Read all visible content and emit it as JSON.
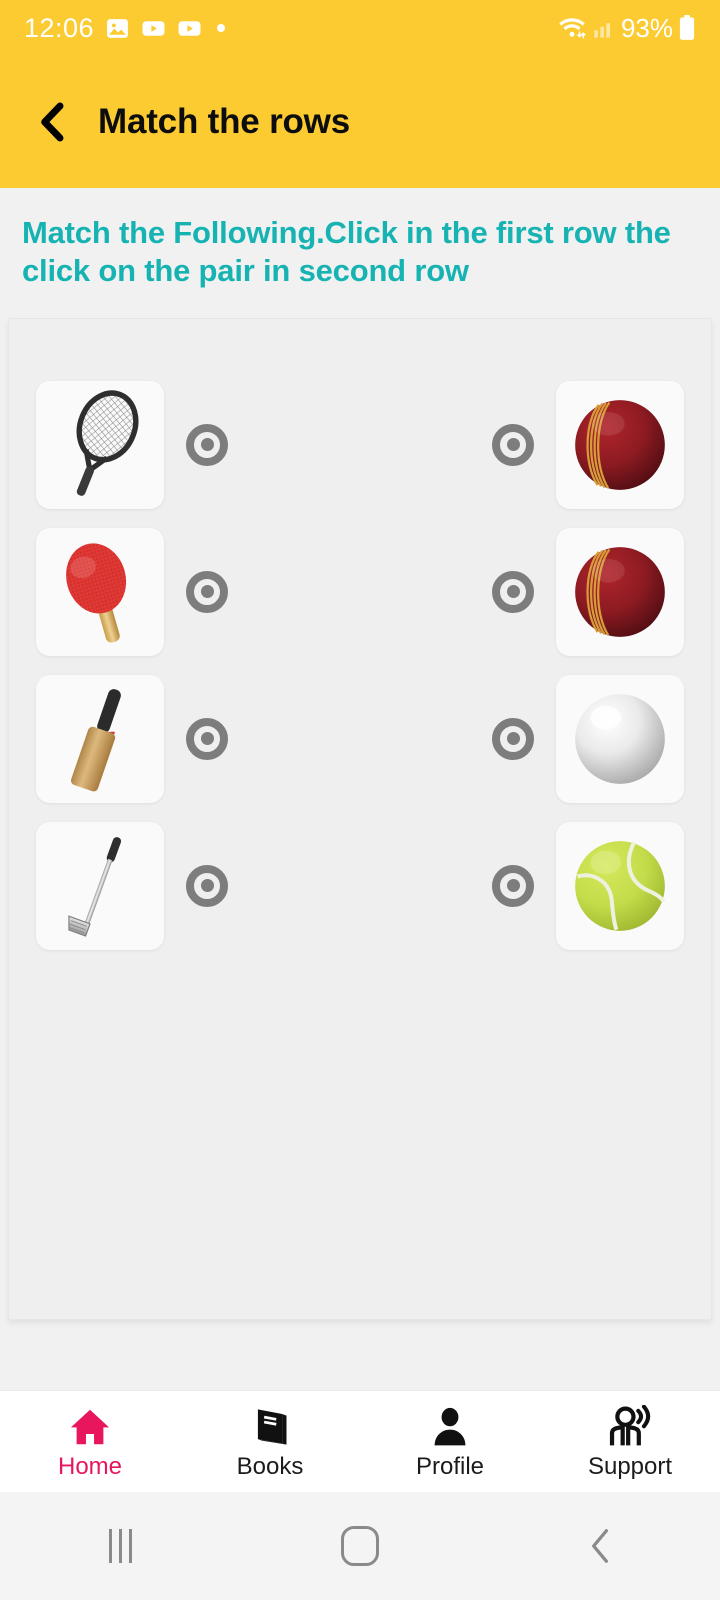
{
  "status_bar": {
    "time": "12:06",
    "battery_percent": "93%",
    "icons": [
      "image-icon",
      "youtube-icon",
      "youtube-icon",
      "dot-indicator",
      "wifi-icon",
      "signal-icon",
      "battery-icon"
    ]
  },
  "app_bar": {
    "back_label": "Back",
    "title": "Match the rows",
    "background_color": "#fccb32",
    "title_color": "#0d0d0d"
  },
  "instruction": {
    "text": "Match the Following.Click in the first row the click on the pair in second row",
    "color": "#17b3b3"
  },
  "match_game": {
    "rows": [
      {
        "left_item": "tennis-racket",
        "left_label": "Tennis racket",
        "right_item": "cricket-ball-red",
        "right_label": "Red cricket ball",
        "left_selected": true,
        "right_selected": true
      },
      {
        "left_item": "table-tennis-paddle",
        "left_label": "Table tennis paddle",
        "right_item": "cricket-ball-red",
        "right_label": "Red cricket ball",
        "left_selected": true,
        "right_selected": true
      },
      {
        "left_item": "cricket-bat",
        "left_label": "Cricket bat",
        "right_item": "white-ball",
        "right_label": "White ball",
        "left_selected": true,
        "right_selected": true
      },
      {
        "left_item": "golf-club",
        "left_label": "Golf club",
        "right_item": "tennis-ball",
        "right_label": "Tennis ball",
        "left_selected": true,
        "right_selected": true
      }
    ],
    "marker_color": "#7d7d7d",
    "card_background": "#efefef"
  },
  "bottom_nav": {
    "active_color": "#e8175d",
    "inactive_color": "#1b1b1b",
    "items": [
      {
        "label": "Home",
        "icon": "home-icon",
        "active": true
      },
      {
        "label": "Books",
        "icon": "book-icon",
        "active": false
      },
      {
        "label": "Profile",
        "icon": "person-icon",
        "active": false
      },
      {
        "label": "Support",
        "icon": "support-agent-icon",
        "active": false
      }
    ]
  },
  "system_nav": {
    "items": [
      {
        "label": "Recents",
        "icon": "recents-icon"
      },
      {
        "label": "Home",
        "icon": "home-square-icon"
      },
      {
        "label": "Back",
        "icon": "back-chevron-icon"
      }
    ]
  }
}
